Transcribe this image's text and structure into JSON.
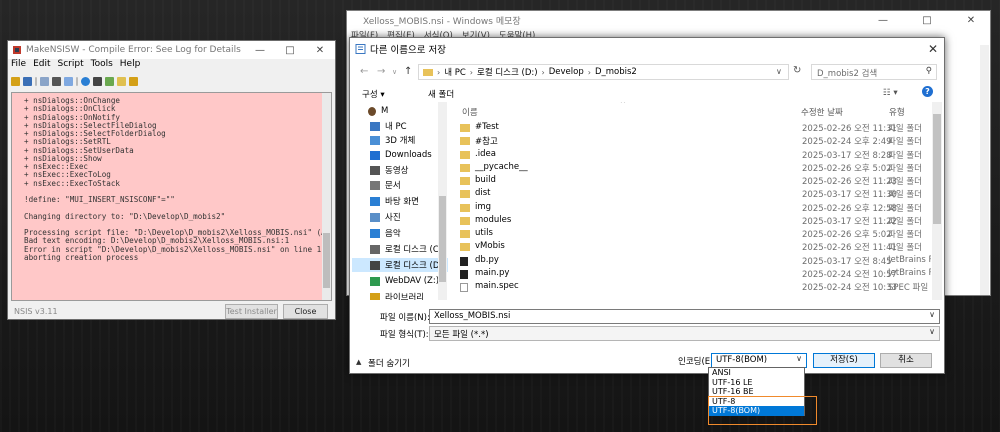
{
  "nsis": {
    "title": "MakeNSISW - Compile Error: See Log for Details",
    "menu": [
      "File",
      "Edit",
      "Script",
      "Tools",
      "Help"
    ],
    "log_lines": [
      "+ nsDialogs::OnChange",
      "+ nsDialogs::OnClick",
      "+ nsDialogs::OnNotify",
      "+ nsDialogs::SelectFileDialog",
      "+ nsDialogs::SelectFolderDialog",
      "+ nsDialogs::SetRTL",
      "+ nsDialogs::SetUserData",
      "+ nsDialogs::Show",
      "+ nsExec::Exec",
      "+ nsExec::ExecToLog",
      "+ nsExec::ExecToStack",
      "",
      "!define: \"MUI_INSERT_NSISCONF\"=\"\"",
      "",
      "Changing directory to: \"D:\\Develop\\D_mobis2\"",
      "",
      "Processing script file: \"D:\\Develop\\D_mobis2\\Xelloss_MOBIS.nsi\" (ACP)",
      "Bad text encoding: D:\\Develop\\D_mobis2\\Xelloss_MOBIS.nsi:1",
      "Error in script \"D:\\Develop\\D_mobis2\\Xelloss_MOBIS.nsi\" on line 1 --",
      "aborting creation process"
    ],
    "version": "NSIS v3.11",
    "test_installer": "Test Installer",
    "close": "Close"
  },
  "notepad": {
    "title": "Xelloss_MOBIS.nsi - Windows 메모장",
    "menu": [
      "파일(F)",
      "편집(E)",
      "서식(O)",
      "보기(V)",
      "도움말(H)"
    ]
  },
  "dialog": {
    "title": "다른 이름으로 저장",
    "close": "✕",
    "breadcrumb": [
      "내 PC",
      "로컬 디스크 (D:)",
      "Develop",
      "D_mobis2"
    ],
    "search_placeholder": "D_mobis2 검색",
    "organize": "구성 ▾",
    "new_folder": "새 폴더",
    "nav_items": [
      "M",
      "내 PC",
      "3D 개체",
      "Downloads",
      "동영상",
      "문서",
      "바탕 화면",
      "사진",
      "음악",
      "로컬 디스크 (C",
      "로컬 디스크 (D",
      "WebDAV (Z:)",
      "라이브러리"
    ],
    "columns": {
      "name": "이름",
      "date": "수정한 날짜",
      "type": "유형"
    },
    "files": [
      {
        "name": "#Test",
        "date": "2025-02-26 오전 11:31",
        "type": "파일 폴더"
      },
      {
        "name": "#참고",
        "date": "2025-02-24 오후 2:49",
        "type": "파일 폴더"
      },
      {
        "name": ".idea",
        "date": "2025-03-17 오전 8:28",
        "type": "파일 폴더"
      },
      {
        "name": "__pycache__",
        "date": "2025-02-26 오후 5:02",
        "type": "파일 폴더"
      },
      {
        "name": "build",
        "date": "2025-02-26 오전 11:23",
        "type": "파일 폴더"
      },
      {
        "name": "dist",
        "date": "2025-03-17 오전 11:30",
        "type": "파일 폴더"
      },
      {
        "name": "img",
        "date": "2025-02-26 오후 12:58",
        "type": "파일 폴더"
      },
      {
        "name": "modules",
        "date": "2025-03-17 오전 11:22",
        "type": "파일 폴더"
      },
      {
        "name": "utils",
        "date": "2025-02-26 오후 5:02",
        "type": "파일 폴더"
      },
      {
        "name": "vMobis",
        "date": "2025-02-26 오전 11:41",
        "type": "파일 폴더"
      },
      {
        "name": "db.py",
        "date": "2025-03-17 오전 8:45",
        "type": "JetBrains PyC"
      },
      {
        "name": "main.py",
        "date": "2025-02-24 오전 10:57",
        "type": "JetBrains PyC"
      },
      {
        "name": "main.spec",
        "date": "2025-02-24 오전 10:33",
        "type": "SPEC 파일"
      }
    ],
    "filename_label": "파일 이름(N):",
    "filename_value": "Xelloss_MOBIS.nsi",
    "filetype_label": "파일 형식(T):",
    "filetype_value": "모든 파일 (*.*)",
    "hide_folders": "폴더 숨기기",
    "encoding_label": "인코딩(E):",
    "encoding_value": "UTF-8(BOM)",
    "save": "저장(S)",
    "cancel": "취소",
    "encoding_options": [
      "ANSI",
      "UTF-16 LE",
      "UTF-16 BE",
      "UTF-8",
      "UTF-8(BOM)"
    ]
  }
}
